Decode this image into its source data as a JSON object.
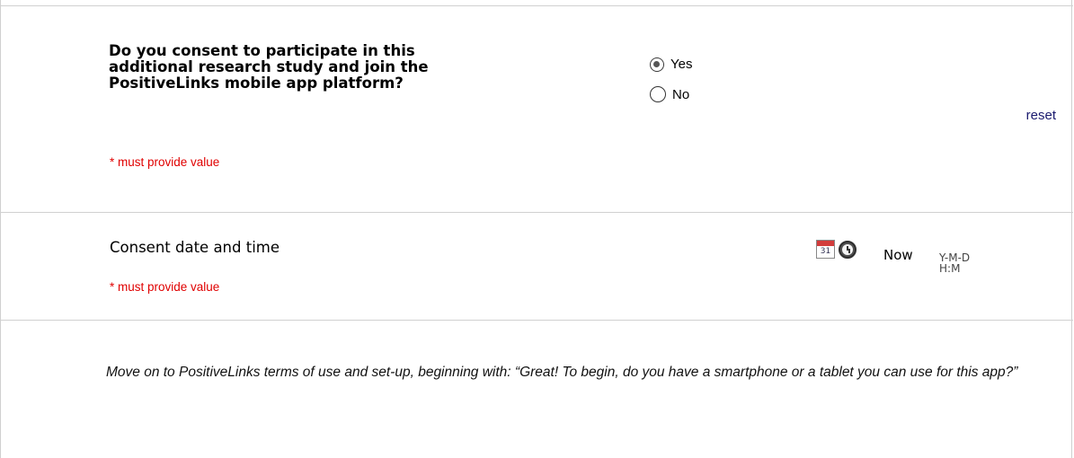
{
  "question1": {
    "label": "Do you consent to participate in this additional research study and join the PositiveLinks mobile app platform?",
    "required_note": "* must provide value",
    "options": [
      {
        "label": "Yes",
        "selected": true
      },
      {
        "label": "No",
        "selected": false
      }
    ],
    "reset_label": "reset"
  },
  "question2": {
    "label": "Consent date and time",
    "required_note": "* must provide value",
    "calendar_icon_text": "31",
    "now_label": "Now",
    "format_hint_date": "Y-M-D",
    "format_hint_time": "H:M"
  },
  "descriptive": {
    "text": "Move on to PositiveLinks terms of use and set-up, beginning with: “Great! To begin, do you have a smartphone or a tablet you can use for this app?”"
  },
  "colors": {
    "required": "#e00000",
    "link": "#1a1a6e",
    "border": "#d0d0d0"
  }
}
